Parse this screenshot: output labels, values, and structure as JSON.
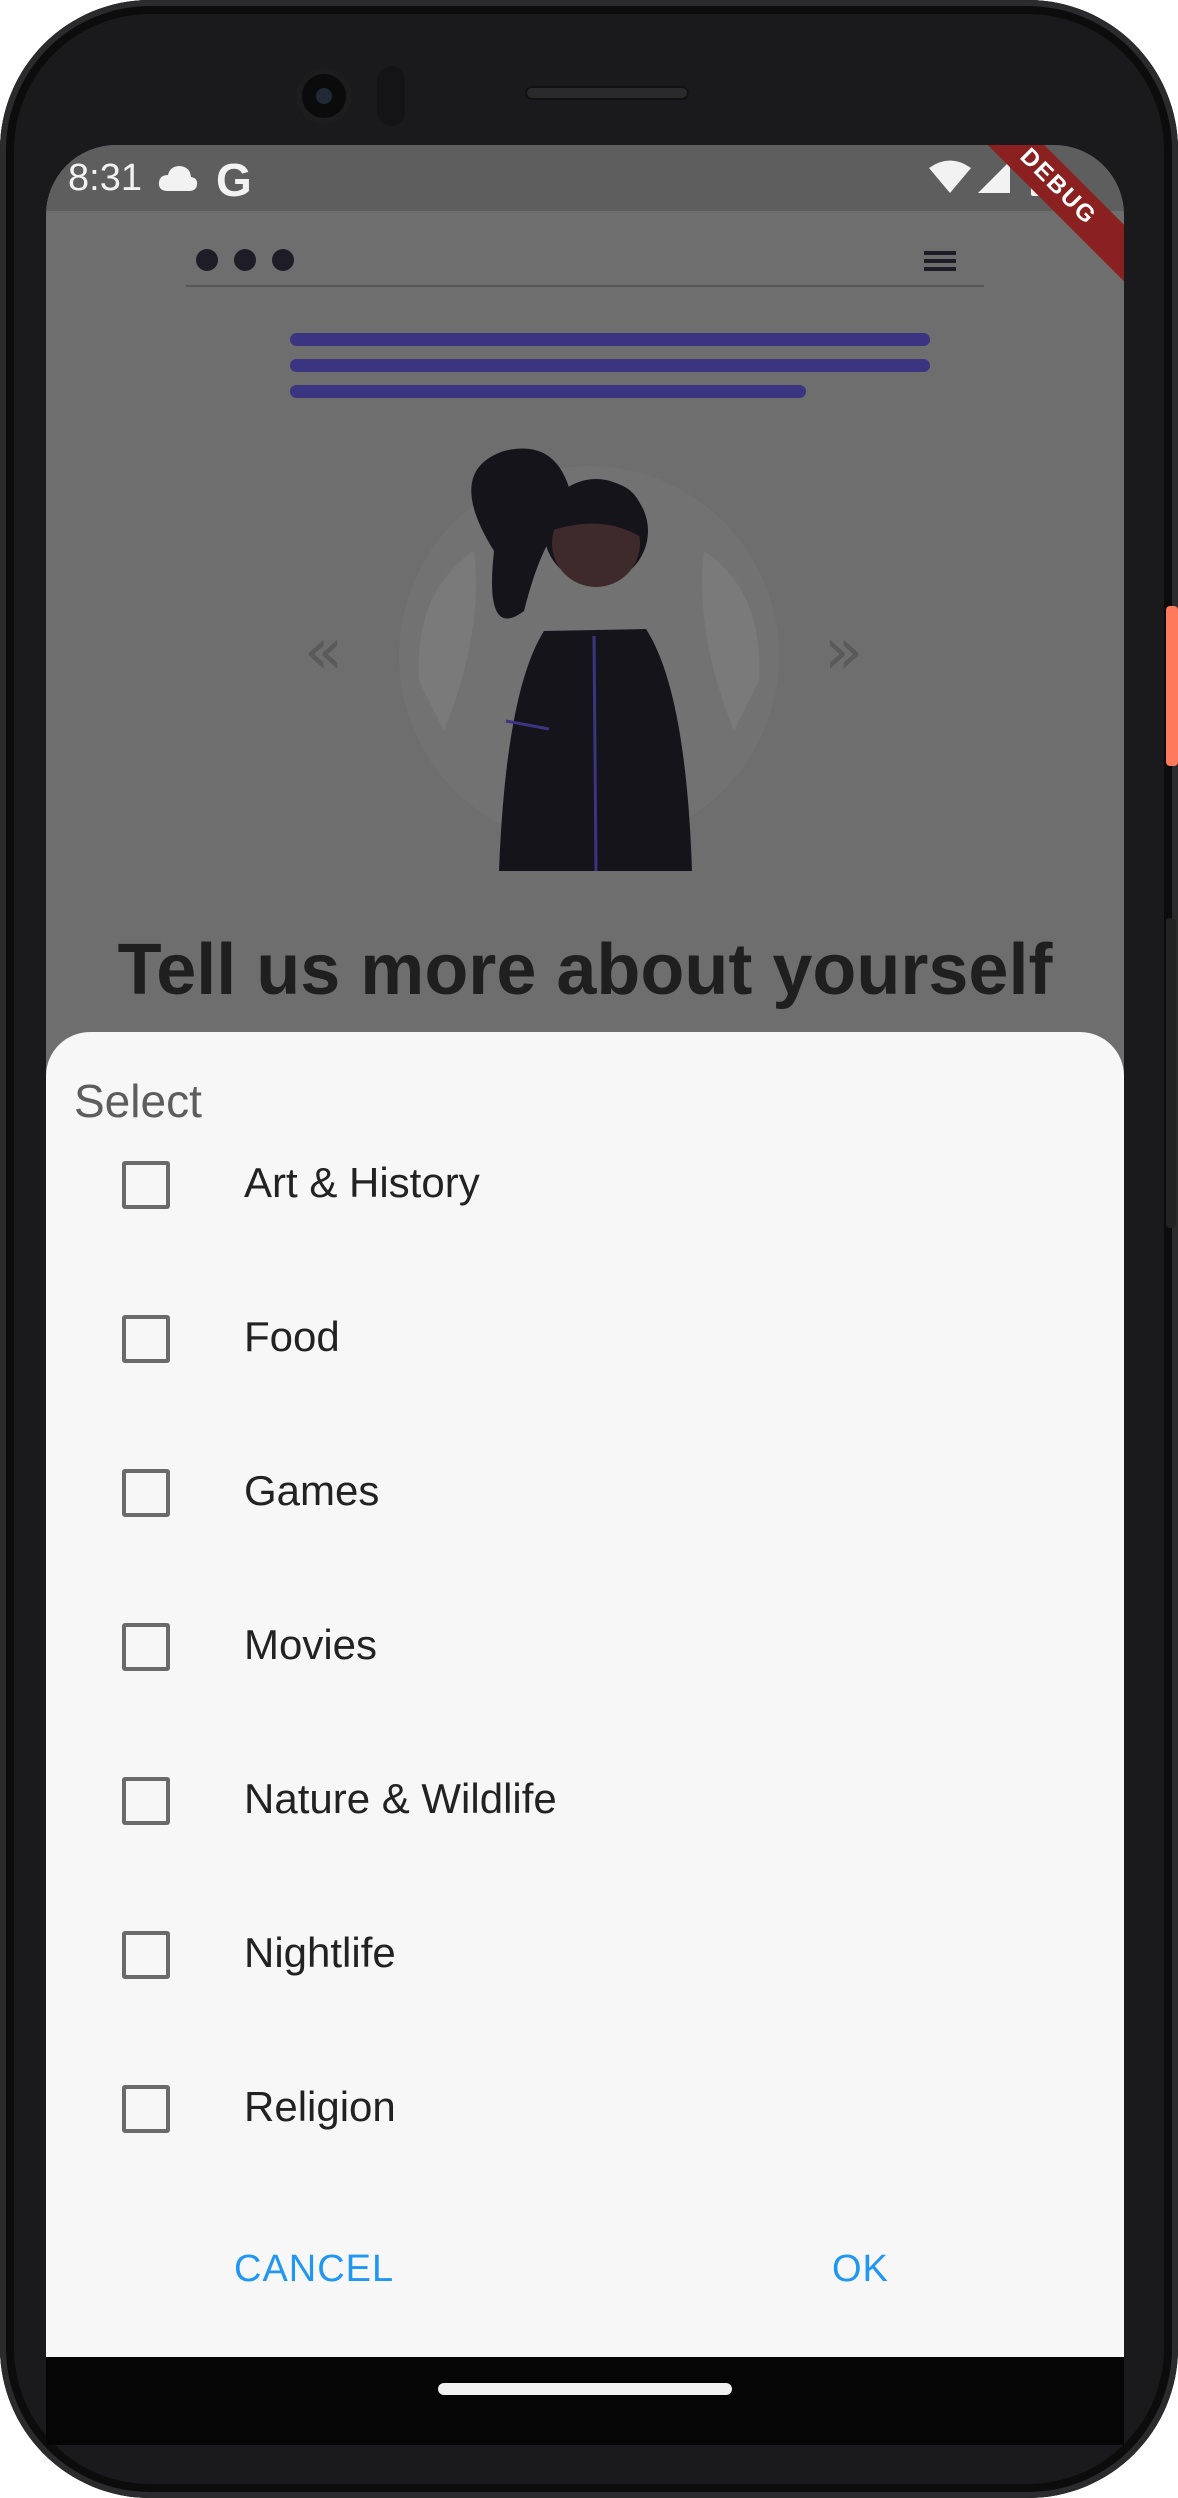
{
  "status_bar": {
    "time": "8:31",
    "left_icons": [
      "cloud-icon",
      "google-g-icon"
    ],
    "right_icons": [
      "wifi-icon",
      "cellular-signal-icon",
      "battery-icon"
    ],
    "g_glyph": "G"
  },
  "debug_banner": "DEBUG",
  "background": {
    "title": "Tell us more about yourself",
    "header_icons": [
      "dots-icon",
      "menu-icon"
    ],
    "accent_color": "#3b3480"
  },
  "dialog": {
    "title": "Select",
    "options": [
      {
        "label": "Art & History",
        "checked": false
      },
      {
        "label": "Food",
        "checked": false
      },
      {
        "label": "Games",
        "checked": false
      },
      {
        "label": "Movies",
        "checked": false
      },
      {
        "label": "Nature & Wildlife",
        "checked": false
      },
      {
        "label": "Nightlife",
        "checked": false
      },
      {
        "label": "Religion",
        "checked": false
      }
    ],
    "cancel_label": "CANCEL",
    "ok_label": "OK",
    "button_color": "#2196f3"
  }
}
